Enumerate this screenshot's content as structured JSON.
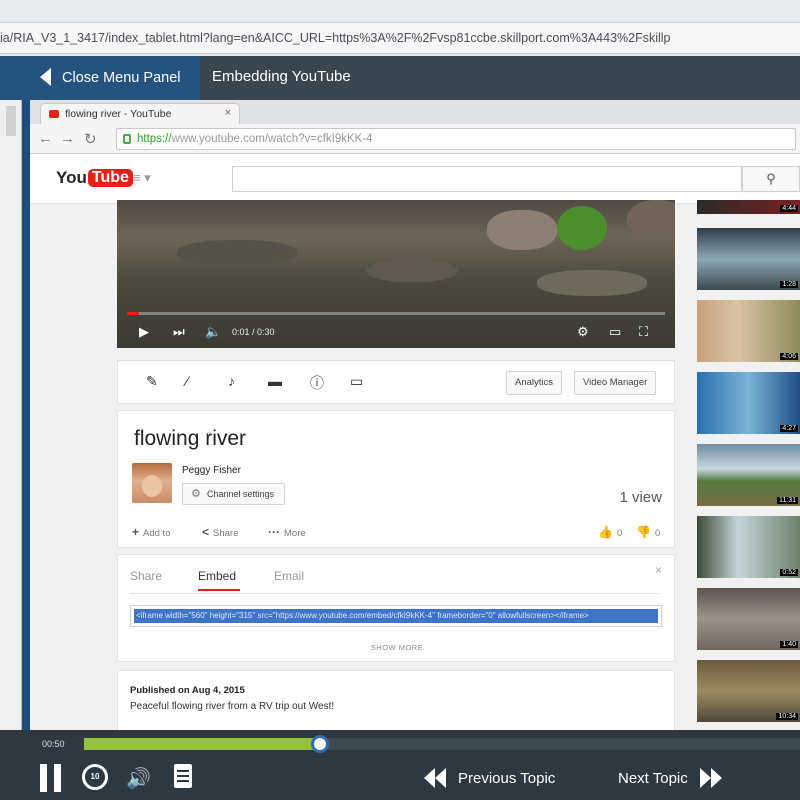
{
  "outer_browser": {
    "url": "ia/RIA_V3_1_3417/index_tablet.html?lang=en&AICC_URL=https%3A%2F%2Fvsp81ccbe.skillport.com%3A443%2Fskillp"
  },
  "player": {
    "close_menu_label": "Close Menu Panel",
    "title": "Embedding YouTube",
    "time": "00:50",
    "progress_fraction": 0.33,
    "prev_label": "Previous Topic",
    "next_label": "Next Topic",
    "replay_seconds": "10"
  },
  "inner_browser": {
    "tab_title": "flowing river - YouTube",
    "url_https": "https://",
    "url_rest": "www.youtube.com/watch?v=cfkI9kKK-4"
  },
  "youtube": {
    "logo_text": "You",
    "logo_tube": "Tube",
    "video": {
      "time": "0:01 / 0:30"
    },
    "toolbar": {
      "analytics_label": "Analytics",
      "video_manager_label": "Video Manager"
    },
    "info": {
      "title": "flowing river",
      "uploader": "Peggy Fisher",
      "channel_settings_label": "Channel settings",
      "views": "1 view",
      "add_to": "Add to",
      "share": "Share",
      "more": "More",
      "likes": "0",
      "dislikes": "0"
    },
    "share_panel": {
      "tabs": [
        "Share",
        "Embed",
        "Email"
      ],
      "embed_code": "<iframe width=\"560\" height=\"315\" src=\"https://www.youtube.com/embed/cfkI9kKK-4\" frameborder=\"0\" allowfullscreen></iframe>",
      "show_more": "SHOW MORE"
    },
    "description": {
      "published": "Published on Aug 4, 2015",
      "text": "Peaceful flowing river from a RV trip out West!"
    },
    "related_durations": [
      "4:44",
      "1:28",
      "4:06",
      "4:27",
      "11:31",
      "0:52",
      "1:40",
      "10:34"
    ]
  },
  "colors": {
    "player_blue": "#245380",
    "seek_green": "#94c23c",
    "youtube_red": "#e62117",
    "embed_highlight": "#3e73c8"
  }
}
